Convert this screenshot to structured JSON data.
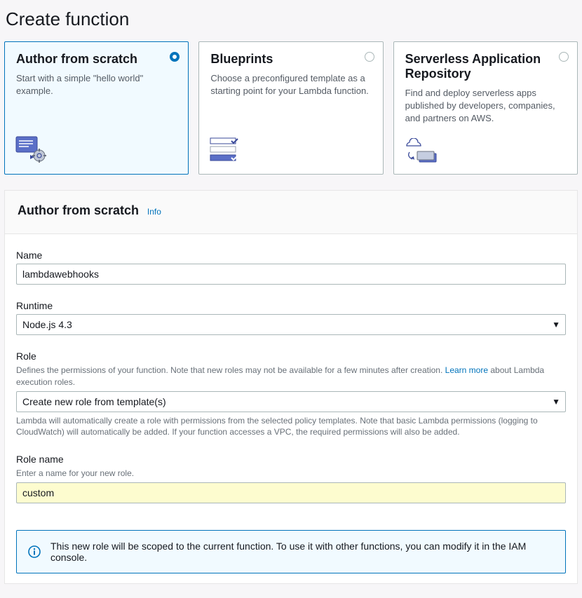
{
  "page_title": "Create function",
  "cards": [
    {
      "title": "Author from scratch",
      "desc": "Start with a simple \"hello world\" example.",
      "selected": true
    },
    {
      "title": "Blueprints",
      "desc": "Choose a preconfigured template as a starting point for your Lambda function.",
      "selected": false
    },
    {
      "title": "Serverless Application Repository",
      "desc": "Find and deploy serverless apps published by developers, companies, and partners on AWS.",
      "selected": false
    }
  ],
  "section": {
    "title": "Author from scratch",
    "info_label": "Info"
  },
  "fields": {
    "name": {
      "label": "Name",
      "value": "lambdawebhooks"
    },
    "runtime": {
      "label": "Runtime",
      "value": "Node.js 4.3"
    },
    "role": {
      "label": "Role",
      "hint_before_link": "Defines the permissions of your function. Note that new roles may not be available for a few minutes after creation. ",
      "hint_link": "Learn more",
      "hint_after_link": " about Lambda execution roles.",
      "value": "Create new role from template(s)",
      "hint_below": "Lambda will automatically create a role with permissions from the selected policy templates. Note that basic Lambda permissions (logging to CloudWatch) will automatically be added. If your function accesses a VPC, the required permissions will also be added."
    },
    "role_name": {
      "label": "Role name",
      "hint": "Enter a name for your new role.",
      "value": "custom"
    }
  },
  "info_box": {
    "text": "This new role will be scoped to the current function. To use it with other functions, you can modify it in the IAM console."
  }
}
